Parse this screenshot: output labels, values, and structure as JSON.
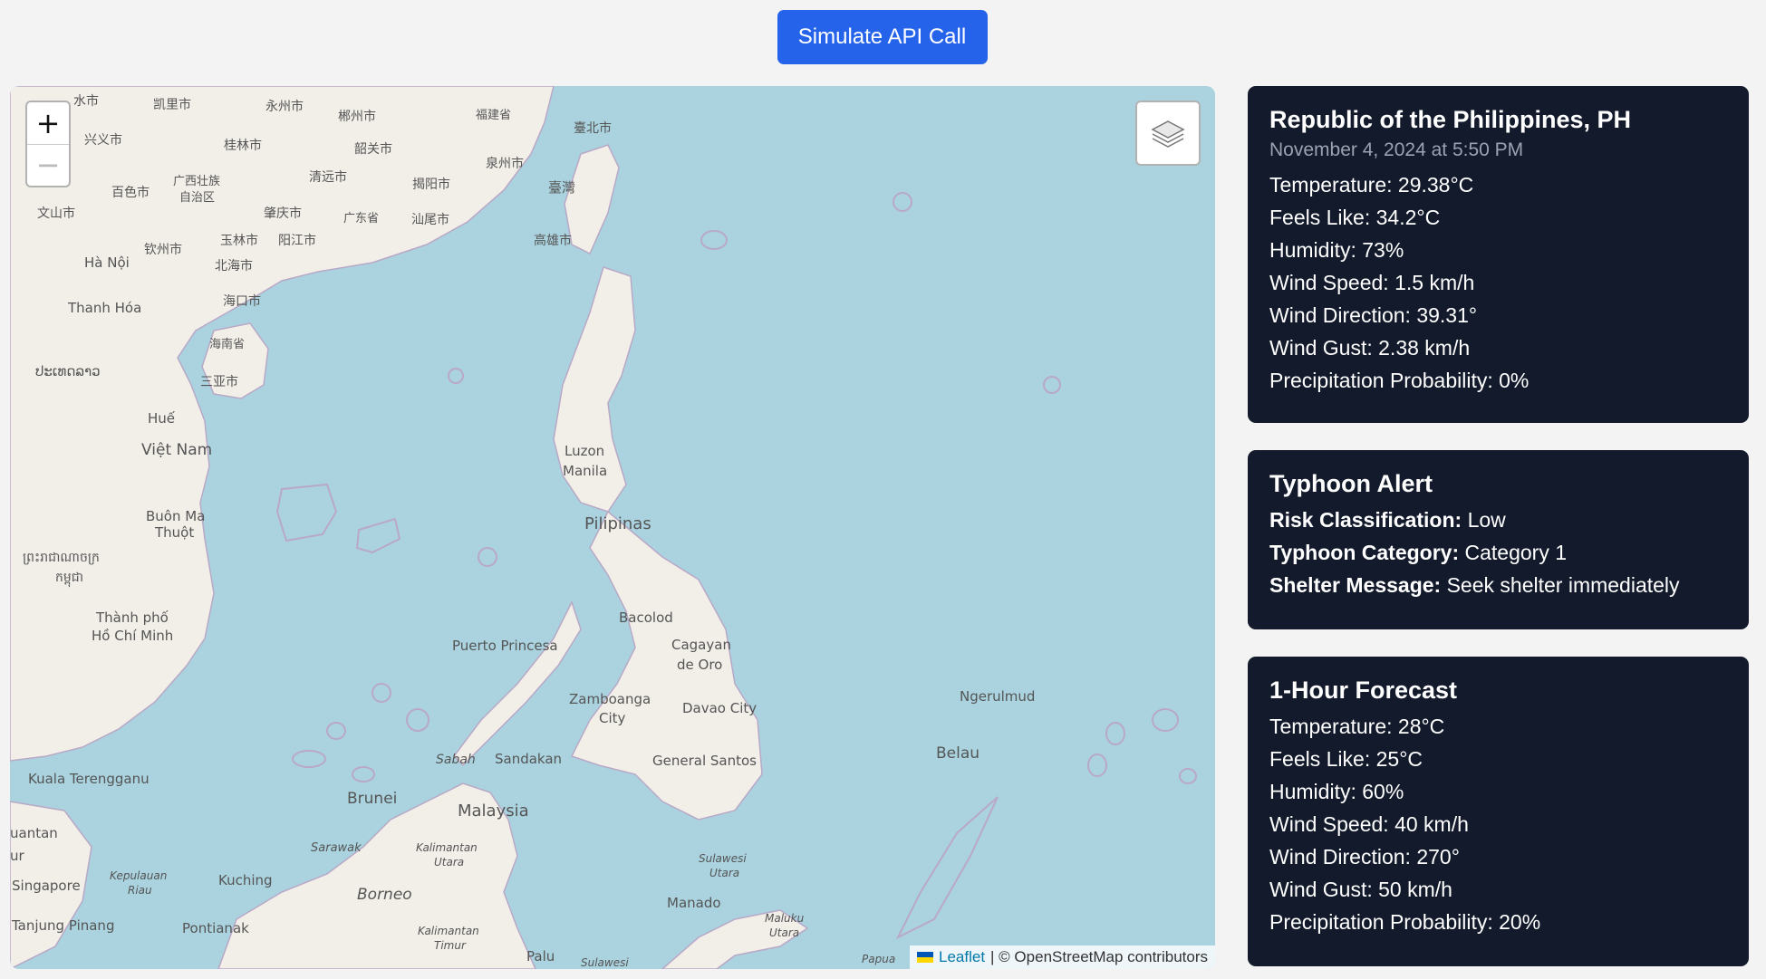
{
  "header": {
    "simulate_label": "Simulate API Call"
  },
  "map": {
    "zoom_in": "+",
    "zoom_out": "−",
    "attribution_link": "Leaflet",
    "attribution_text": "| © OpenStreetMap contributors",
    "labels": {
      "luzon": "Luzon",
      "manila": "Manila",
      "pilipinas": "Pilipinas",
      "bacolod": "Bacolod",
      "cagayan": "Cagayan",
      "de_oro": "de Oro",
      "puerto_princesa": "Puerto Princesa",
      "zamboanga": "Zamboanga",
      "city": "City",
      "davao": "Davao City",
      "general_santos": "General Santos",
      "sandakan": "Sandakan",
      "sabah": "Sabah",
      "brunei": "Brunei",
      "malaysia": "Malaysia",
      "sarawak": "Sarawak",
      "borneo": "Borneo",
      "kuching": "Kuching",
      "pontianak": "Pontianak",
      "singapore": "Singapore",
      "tanjung_pinang": "Tanjung Pinang",
      "kuala_terengganu": "Kuala Terengganu",
      "uantan": "uantan",
      "ur": "ur",
      "kepulauan": "Kepulauan",
      "riau": "Riau",
      "kalimantan_utara": "Kalimantan",
      "utara": "Utara",
      "kalimantan_timur": "Kalimantan",
      "timur": "Timur",
      "sulawesi_utara": "Sulawesi",
      "utara2": "Utara",
      "manado": "Manado",
      "maluku": "Maluku",
      "utara3": "Utara",
      "palu": "Palu",
      "sulawesi": "Sulawesi",
      "papua": "Papua",
      "ngerulmud": "Ngerulmud",
      "belau": "Belau",
      "viet_nam": "Việt Nam",
      "hue": "Huế",
      "buon_ma": "Buôn Ma",
      "thuot": "Thuột",
      "thanh_pho": "Thành phố",
      "ho_chi_minh": "Hồ Chí Minh",
      "ha_noi": "Hà Nội",
      "thanh_hoa": "Thanh Hóa",
      "laos": "ປະເທດລາວ",
      "cambodia1": "ព្រះរាជាណាចក្រ",
      "cambodia2": "កម្ពុជា",
      "taibei": "臺北市",
      "taiwan": "臺灣",
      "gaoxiong": "高雄市",
      "fujian": "福建省",
      "quanzhou": "泉州市",
      "jieyang": "揭阳市",
      "shanwei": "汕尾市",
      "guangdong": "广东省",
      "zhaoqing": "肇庆市",
      "yangjiang": "阳江市",
      "yulin": "玉林市",
      "qinzhou": "钦州市",
      "beihai": "北海市",
      "haikou": "海口市",
      "hainan": "海南省",
      "sanya": "三亚市",
      "guangxi1": "广西壮族",
      "guangxi2": "自治区",
      "baise": "百色市",
      "wenshan": "文山市",
      "xingyi": "兴义市",
      "guilin": "桂林市",
      "yongzhou": "永州市",
      "chenzhou": "郴州市",
      "shaoguan": "韶关市",
      "qingyuan": "清远市",
      "kaili": "凯里市",
      "lishui": "水市"
    }
  },
  "current": {
    "title": "Republic of the Philippines, PH",
    "date": "November 4, 2024 at 5:50 PM",
    "temperature": "Temperature: 29.38°C",
    "feels_like": "Feels Like: 34.2°C",
    "humidity": "Humidity: 73%",
    "wind_speed": "Wind Speed: 1.5 km/h",
    "wind_direction": "Wind Direction: 39.31°",
    "wind_gust": "Wind Gust: 2.38 km/h",
    "precipitation": "Precipitation Probability: 0%"
  },
  "alert": {
    "title": "Typhoon Alert",
    "risk_label": "Risk Classification:",
    "risk_value": " Low",
    "category_label": "Typhoon Category:",
    "category_value": " Category 1",
    "shelter_label": "Shelter Message:",
    "shelter_value": " Seek shelter immediately"
  },
  "forecast": {
    "title": "1-Hour Forecast",
    "temperature": "Temperature: 28°C",
    "feels_like": "Feels Like: 25°C",
    "humidity": "Humidity: 60%",
    "wind_speed": "Wind Speed: 40 km/h",
    "wind_direction": "Wind Direction: 270°",
    "wind_gust": "Wind Gust: 50 km/h",
    "precipitation": "Precipitation Probability: 20%"
  }
}
